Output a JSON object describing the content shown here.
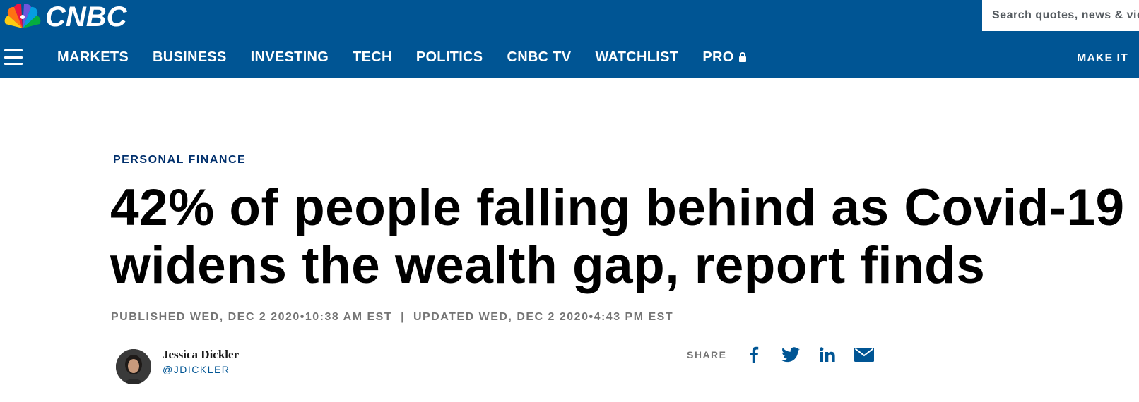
{
  "brand": {
    "name": "CNBC",
    "colors": {
      "header_bg": "#005594",
      "peacock": [
        "#fccc12",
        "#ef1541",
        "#6e55dc",
        "#069de0",
        "#05ac3f",
        "#ff7112"
      ]
    }
  },
  "search": {
    "placeholder": "Search quotes, news & videos"
  },
  "nav": {
    "menu_icon": "hamburger-icon",
    "items": [
      "MARKETS",
      "BUSINESS",
      "INVESTING",
      "TECH",
      "POLITICS",
      "CNBC TV",
      "WATCHLIST",
      "PRO"
    ],
    "pro_icon": "lock-icon",
    "right_label": "MAKE IT"
  },
  "article": {
    "section": "PERSONAL FINANCE",
    "headline": "42% of people falling behind as Covid-19 widens the wealth gap, report finds",
    "published": "PUBLISHED WED, DEC 2 2020•10:38 AM EST",
    "separator": "|",
    "updated": "UPDATED WED, DEC 2 2020•4:43 PM EST",
    "author": {
      "name": "Jessica Dickler",
      "handle": "@JDICKLER"
    },
    "share": {
      "label": "SHARE",
      "icons": [
        "facebook-icon",
        "twitter-icon",
        "linkedin-icon",
        "email-icon"
      ],
      "color": "#005594"
    }
  }
}
